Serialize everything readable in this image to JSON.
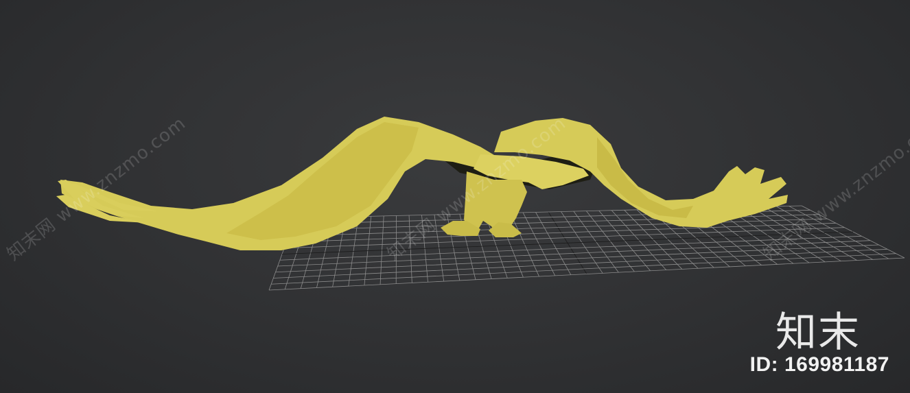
{
  "watermarks": [
    {
      "text": "知末网 www.znzmo.com"
    },
    {
      "text": "知末网 www.znzmo.com"
    },
    {
      "text": "知末网 www.znzmo.com"
    }
  ],
  "brand": {
    "logo": "知末",
    "id_label": "ID: 169981187"
  },
  "scene": {
    "model": "eagle-model",
    "model_color": "#d8cd5a",
    "grid_color": "#9a9a9a",
    "background_color": "#303133"
  }
}
